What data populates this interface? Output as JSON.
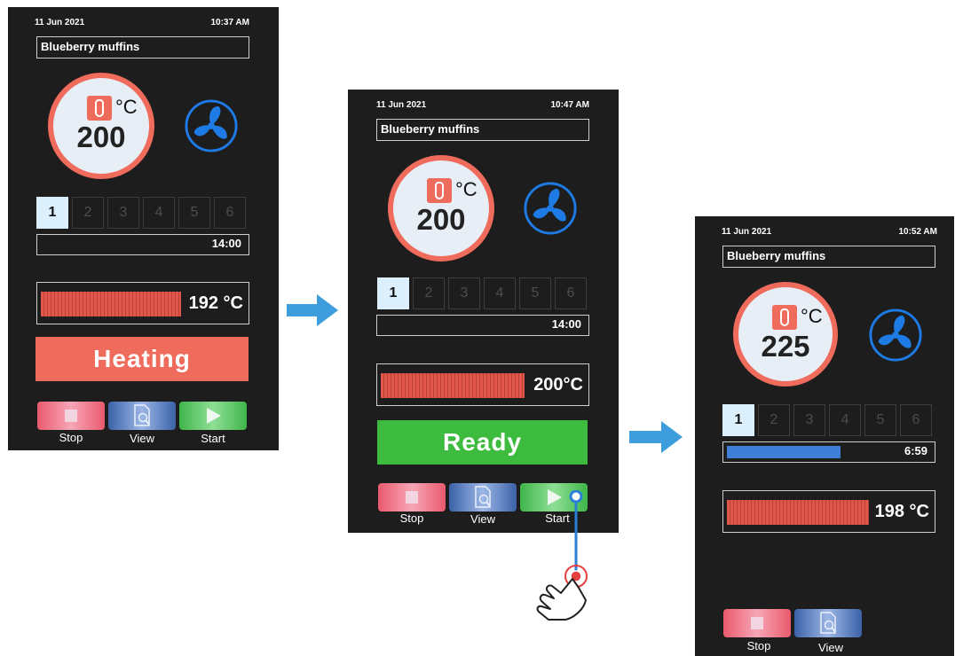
{
  "screens": [
    {
      "date": "11 Jun 2021",
      "time": "10:37 AM",
      "recipe": "Blueberry muffins",
      "set_temp": "200",
      "unit": "°C",
      "steps": [
        "1",
        "2",
        "3",
        "4",
        "5",
        "6"
      ],
      "active_step": "1",
      "timer": "14:00",
      "oven_temp": "192 °C",
      "status": "Heating",
      "buttons": {
        "stop": "Stop",
        "view": "View",
        "start": "Start"
      }
    },
    {
      "date": "11 Jun 2021",
      "time": "10:47 AM",
      "recipe": "Blueberry muffins",
      "set_temp": "200",
      "unit": "°C",
      "steps": [
        "1",
        "2",
        "3",
        "4",
        "5",
        "6"
      ],
      "active_step": "1",
      "timer": "14:00",
      "oven_temp": "200°C",
      "status": "Ready",
      "buttons": {
        "stop": "Stop",
        "view": "View",
        "start": "Start"
      }
    },
    {
      "date": "11 Jun 2021",
      "time": "10:52 AM",
      "recipe": "Blueberry muffins",
      "set_temp": "225",
      "unit": "°C",
      "steps": [
        "1",
        "2",
        "3",
        "4",
        "5",
        "6"
      ],
      "active_step": "1",
      "timer": "6:59",
      "progress_fraction": 0.55,
      "oven_temp": "198 °C",
      "buttons": {
        "stop": "Stop",
        "view": "View"
      }
    }
  ],
  "colors": {
    "heating": "#ef6b5c",
    "ready": "#3dbb3f",
    "fan": "#1e7be6",
    "progress": "#3f7ed6",
    "arrow": "#3d9ddd"
  },
  "icons": [
    "thermometer-icon",
    "fan-icon",
    "stop-icon",
    "view-icon",
    "play-icon",
    "hand-pointer-icon",
    "arrow-right-icon"
  ]
}
